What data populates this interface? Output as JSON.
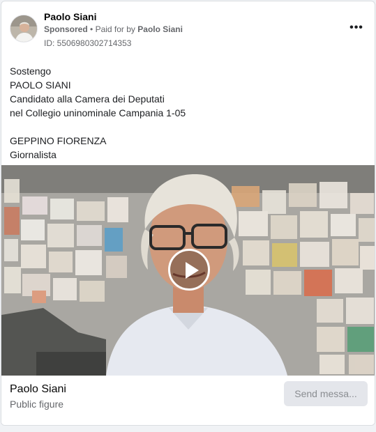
{
  "post": {
    "page_name": "Paolo Siani",
    "sponsored_label": "Sponsored",
    "separator": "•",
    "paid_for_prefix": "Paid for by",
    "paid_for_name": "Paolo Siani",
    "ad_id": "ID: 5506980302714353",
    "more_icon": "more-horizontal-icon",
    "more_label": "•••"
  },
  "body": {
    "lines": [
      "Sostengo",
      "PAOLO SIANI",
      "Candidato alla Camera dei Deputati",
      "nel Collegio uninominale Campania 1-05",
      "",
      "GEPPINO FIORENZA",
      "Giornalista"
    ]
  },
  "video": {
    "play_icon": "play-icon"
  },
  "footer": {
    "name": "Paolo Siani",
    "category": "Public figure",
    "cta_label": "Send messa..."
  },
  "colors": {
    "text_primary": "#050505",
    "text_secondary": "#65676b",
    "button_bg": "#e4e6eb",
    "button_text": "#8a8d91",
    "card_border": "#dadde1"
  }
}
